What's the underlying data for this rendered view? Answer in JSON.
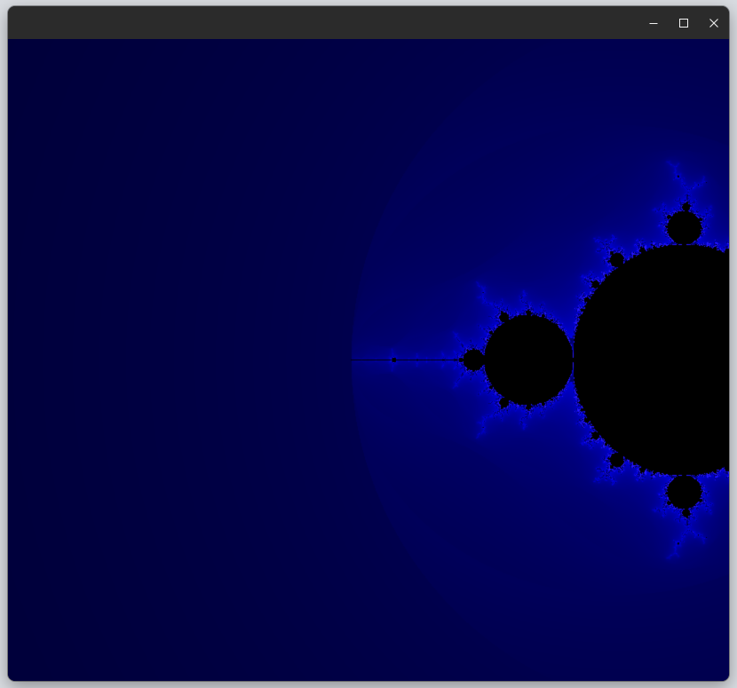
{
  "window": {
    "title": "",
    "controls": {
      "minimize_icon": "minimize-icon",
      "maximize_icon": "maximize-icon",
      "close_icon": "close-icon"
    }
  },
  "canvas": {
    "content": "mandelbrot-fractal",
    "set_color": "#000000",
    "edge_color": "#2a2aff",
    "background_color": "#05053a"
  }
}
